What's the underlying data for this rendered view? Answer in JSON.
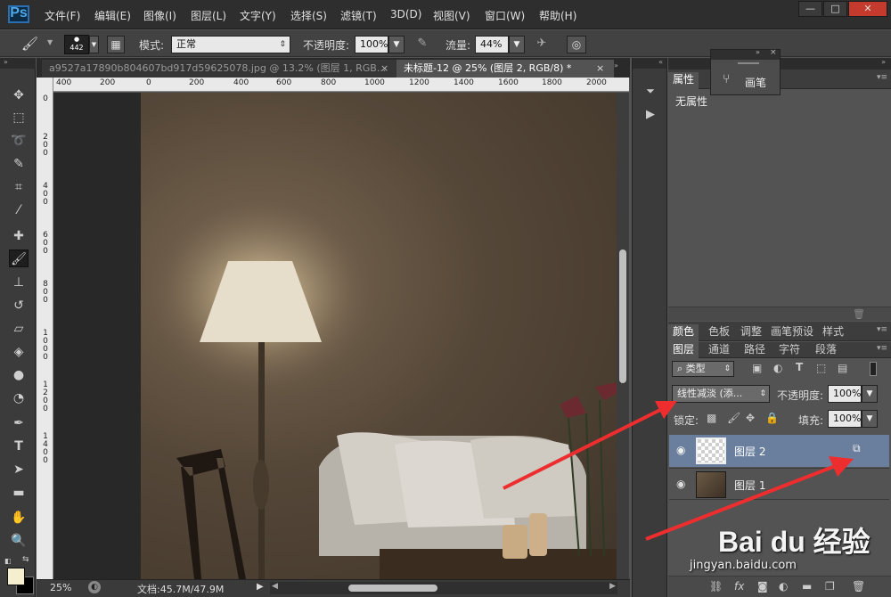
{
  "app": {
    "logo": "Ps"
  },
  "menu": [
    "文件(F)",
    "编辑(E)",
    "图像(I)",
    "图层(L)",
    "文字(Y)",
    "选择(S)",
    "滤镜(T)",
    "3D(D)",
    "视图(V)",
    "窗口(W)",
    "帮助(H)"
  ],
  "window_controls": {
    "minimize": "—",
    "maximize": "□",
    "close": "✕"
  },
  "options": {
    "brush_size": "442",
    "mode_label": "模式:",
    "mode_value": "正常",
    "opacity_label": "不透明度:",
    "opacity_value": "100%",
    "flow_label": "流量:",
    "flow_value": "44%"
  },
  "tabs": [
    {
      "label": "a9527a17890b804607bd917d59625078.jpg @ 13.2% (图层 1, RGB...",
      "close": "×"
    },
    {
      "label": "未标题-12 @ 25% (图层 2, RGB/8) *",
      "close": "×"
    }
  ],
  "hruler_ticks": [
    "400",
    "200",
    "0",
    "200",
    "400",
    "600",
    "800",
    "1000",
    "1200",
    "1400",
    "1600",
    "1800",
    "2000"
  ],
  "vruler_ticks": [
    "0",
    "2",
    "0",
    "4",
    "0",
    "6",
    "0",
    "8",
    "0",
    "1",
    "0",
    "1",
    "2",
    "1",
    "4",
    "1",
    "6"
  ],
  "status": {
    "zoom": "25%",
    "doc": "文档:45.7M/47.9M"
  },
  "brush_float": {
    "label": "画笔"
  },
  "properties_panel": {
    "tab": "属性",
    "content": "无属性"
  },
  "color_panel_tabs": [
    "颜色",
    "色板",
    "调整",
    "画笔预设",
    "样式"
  ],
  "layers_panel_tabs": [
    "图层",
    "通道",
    "路径",
    "字符",
    "段落"
  ],
  "layers": {
    "filter_label": "类型",
    "blend_mode": "线性减淡 (添...",
    "opacity_label": "不透明度:",
    "opacity_value": "100%",
    "lock_label": "锁定:",
    "fill_label": "填充:",
    "fill_value": "100%",
    "items": [
      {
        "name": "图层 2",
        "selected": true
      },
      {
        "name": "图层 1",
        "selected": false
      }
    ]
  },
  "watermark": {
    "brand": "Bai du 经验",
    "url": "jingyan.baidu.com"
  },
  "colors": {
    "accent_arrow": "#ee2e2e",
    "selected_layer": "#6a7f9e",
    "foreground": "#f5efd0"
  }
}
